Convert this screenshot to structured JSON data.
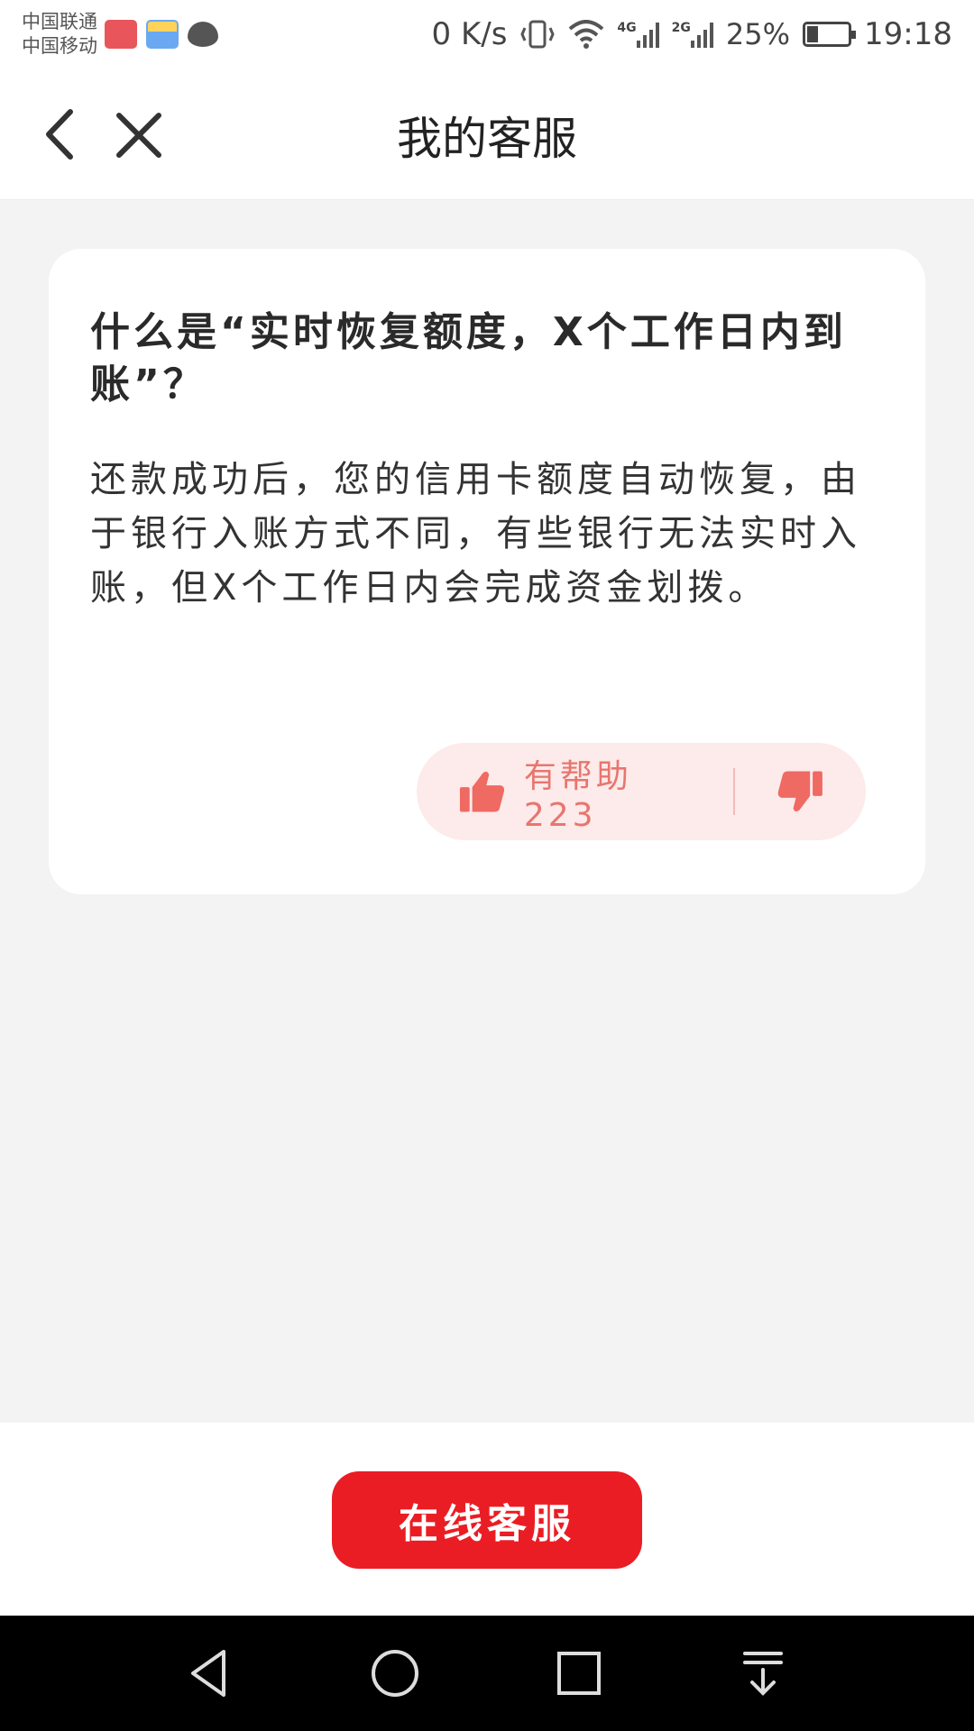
{
  "status_bar": {
    "carrier_1": "中国联通",
    "carrier_2": "中国移动",
    "net_speed": "0 K/s",
    "net_4g": "4G",
    "net_2g": "2G",
    "battery_percent": "25%",
    "time": "19:18"
  },
  "header": {
    "title": "我的客服"
  },
  "faq": {
    "question": "什么是“实时恢复额度，X个工作日内到账”？",
    "answer": "还款成功后，您的信用卡额度自动恢复，由于银行入账方式不同，有些银行无法实时入账，但X个工作日内会完成资金划拨。",
    "helpful_label": "有帮助223"
  },
  "footer": {
    "online_service_label": "在线客服"
  },
  "colors": {
    "accent": "#eb1d24",
    "feedback_bg": "#fdeaea",
    "feedback_icon": "#ef6a62"
  }
}
